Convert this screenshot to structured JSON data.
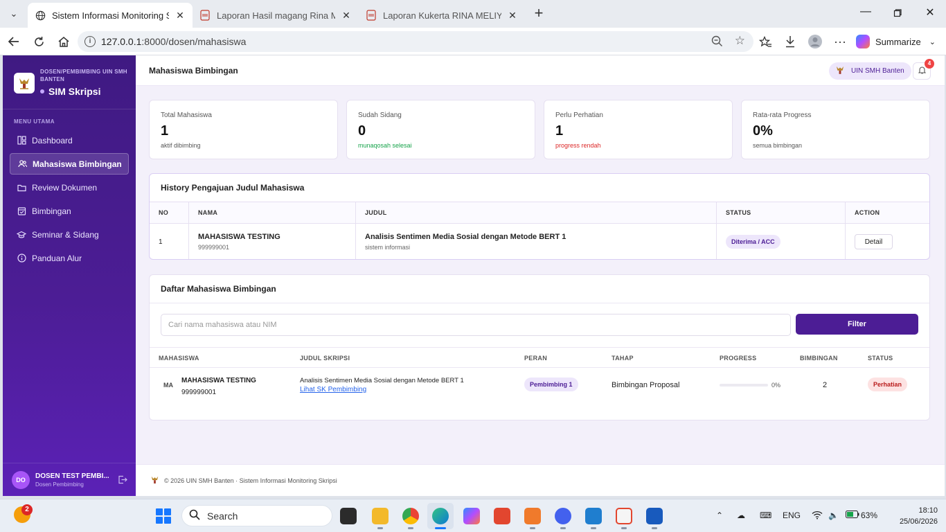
{
  "browser": {
    "tabs": [
      {
        "title": "Sistem Informasi Monitoring Skripsi",
        "active": true,
        "icon": "globe-icon"
      },
      {
        "title": "Laporan Hasil magang Rina Meliyana",
        "active": false,
        "icon": "pdf-icon"
      },
      {
        "title": "Laporan Kukerta RINA MELIYANA",
        "active": false,
        "icon": "pdf-icon"
      }
    ],
    "url_host": "127.0.0.1",
    "url_path": ":8000/dosen/mahasiswa",
    "summarize_label": "Summarize"
  },
  "sidebar": {
    "subtitle": "DOSEN/PEMBIMBING UIN SMH BANTEN",
    "app_name": "SIM Skripsi",
    "menu_heading": "MENU UTAMA",
    "items": [
      {
        "label": "Dashboard",
        "icon": "dashboard-icon",
        "active": false
      },
      {
        "label": "Mahasiswa Bimbingan",
        "icon": "users-icon",
        "active": true
      },
      {
        "label": "Review Dokumen",
        "icon": "folder-icon",
        "active": false
      },
      {
        "label": "Bimbingan",
        "icon": "calendar-icon",
        "active": false
      },
      {
        "label": "Seminar & Sidang",
        "icon": "graduation-cap-icon",
        "active": false
      },
      {
        "label": "Panduan Alur",
        "icon": "info-icon",
        "active": false
      }
    ],
    "user": {
      "initials": "DO",
      "name": "DOSEN TEST PEMBI...",
      "role": "Dosen Pembimbing"
    }
  },
  "header": {
    "title": "Mahasiswa Bimbingan",
    "institution": "UIN SMH Banten",
    "notifications": "4"
  },
  "stats": [
    {
      "label": "Total Mahasiswa",
      "value": "1",
      "note": "aktif dibimbing",
      "tone": "neutral"
    },
    {
      "label": "Sudah Sidang",
      "value": "0",
      "note": "munaqosah selesai",
      "tone": "green"
    },
    {
      "label": "Perlu Perhatian",
      "value": "1",
      "note": "progress rendah",
      "tone": "red"
    },
    {
      "label": "Rata-rata Progress",
      "value": "0%",
      "note": "semua bimbingan",
      "tone": "neutral"
    }
  ],
  "history": {
    "title": "History Pengajuan Judul Mahasiswa",
    "columns": [
      "NO",
      "NAMA",
      "JUDUL",
      "STATUS",
      "ACTION"
    ],
    "rows": [
      {
        "no": "1",
        "name": "MAHASISWA TESTING",
        "nim": "999999001",
        "title": "Analisis Sentimen Media Sosial dengan Metode BERT 1",
        "field": "sistem informasi",
        "status": "Diterima / ACC",
        "action": "Detail"
      }
    ]
  },
  "students": {
    "title": "Daftar Mahasiswa Bimbingan",
    "search_placeholder": "Cari nama mahasiswa atau NIM",
    "filter_label": "Filter",
    "columns": [
      "MAHASISWA",
      "JUDUL SKRIPSI",
      "PERAN",
      "TAHAP",
      "PROGRESS",
      "BIMBINGAN",
      "STATUS"
    ],
    "rows": [
      {
        "initials": "MA",
        "name": "MAHASISWA TESTING",
        "nim": "999999001",
        "title": "Analisis Sentimen Media Sosial dengan Metode BERT 1",
        "sk_link": "Lihat SK Pembimbing",
        "role": "Pembimbing 1",
        "stage": "Bimbingan Proposal",
        "progress": 0,
        "progress_label": "0%",
        "sessions": "2",
        "status": "Perhatian"
      }
    ]
  },
  "footer": {
    "text": "© 2026 UIN SMH Banten · Sistem Informasi Monitoring Skripsi"
  },
  "taskbar": {
    "weather_badge": "2",
    "search_label": "Search",
    "language": "ENG",
    "battery": "63%",
    "time": "18:10",
    "date": "25/06/2026"
  },
  "colors": {
    "primary": "#4c1d95",
    "sidebar": "#3f1a82",
    "warn": "#b91c1c",
    "ok": "#16a34a"
  }
}
